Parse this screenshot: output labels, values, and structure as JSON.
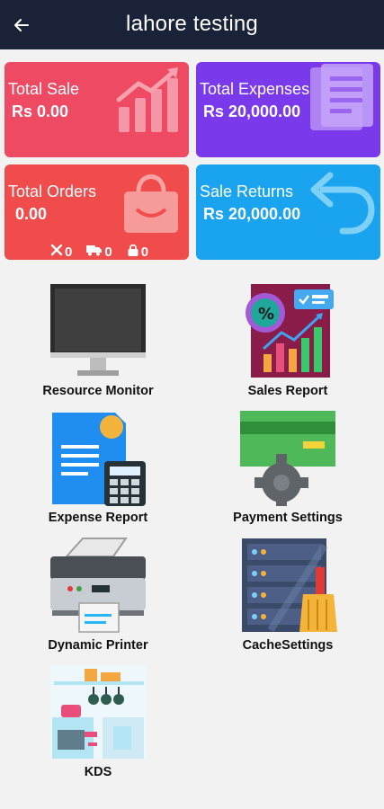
{
  "appbar": {
    "title": "lahore testing",
    "back_icon": "arrow-left-icon"
  },
  "cards": {
    "total_sale": {
      "label": "Total Sale",
      "value": "Rs 0.00",
      "color": "#ee4a63",
      "icon": "trending-up-chart-icon"
    },
    "total_expenses": {
      "label": "Total Expenses",
      "value": "Rs 20,000.00",
      "color": "#7a39ea",
      "icon": "document-icon"
    },
    "total_orders": {
      "label": "Total Orders",
      "value": "0.00",
      "color": "#f04c4c",
      "icon": "shopping-bag-icon",
      "stats": [
        {
          "icon": "cancel-x-icon",
          "value": "0"
        },
        {
          "icon": "truck-icon",
          "value": "0"
        },
        {
          "icon": "lock-bag-icon",
          "value": "0"
        }
      ]
    },
    "sale_returns": {
      "label": "Sale Returns",
      "value": "Rs 20,000.00",
      "color": "#1aa3ee",
      "icon": "return-arrow-icon"
    }
  },
  "menu": [
    {
      "label": "Resource Monitor",
      "icon": "monitor-icon"
    },
    {
      "label": "Sales Report",
      "icon": "sales-report-icon"
    },
    {
      "label": "Expense Report",
      "icon": "expense-report-icon"
    },
    {
      "label": "Payment Settings",
      "icon": "payment-settings-icon"
    },
    {
      "label": "Dynamic Printer",
      "icon": "printer-icon"
    },
    {
      "label": "CacheSettings",
      "icon": "server-broom-icon"
    },
    {
      "label": "KDS",
      "icon": "kitchen-icon"
    }
  ]
}
